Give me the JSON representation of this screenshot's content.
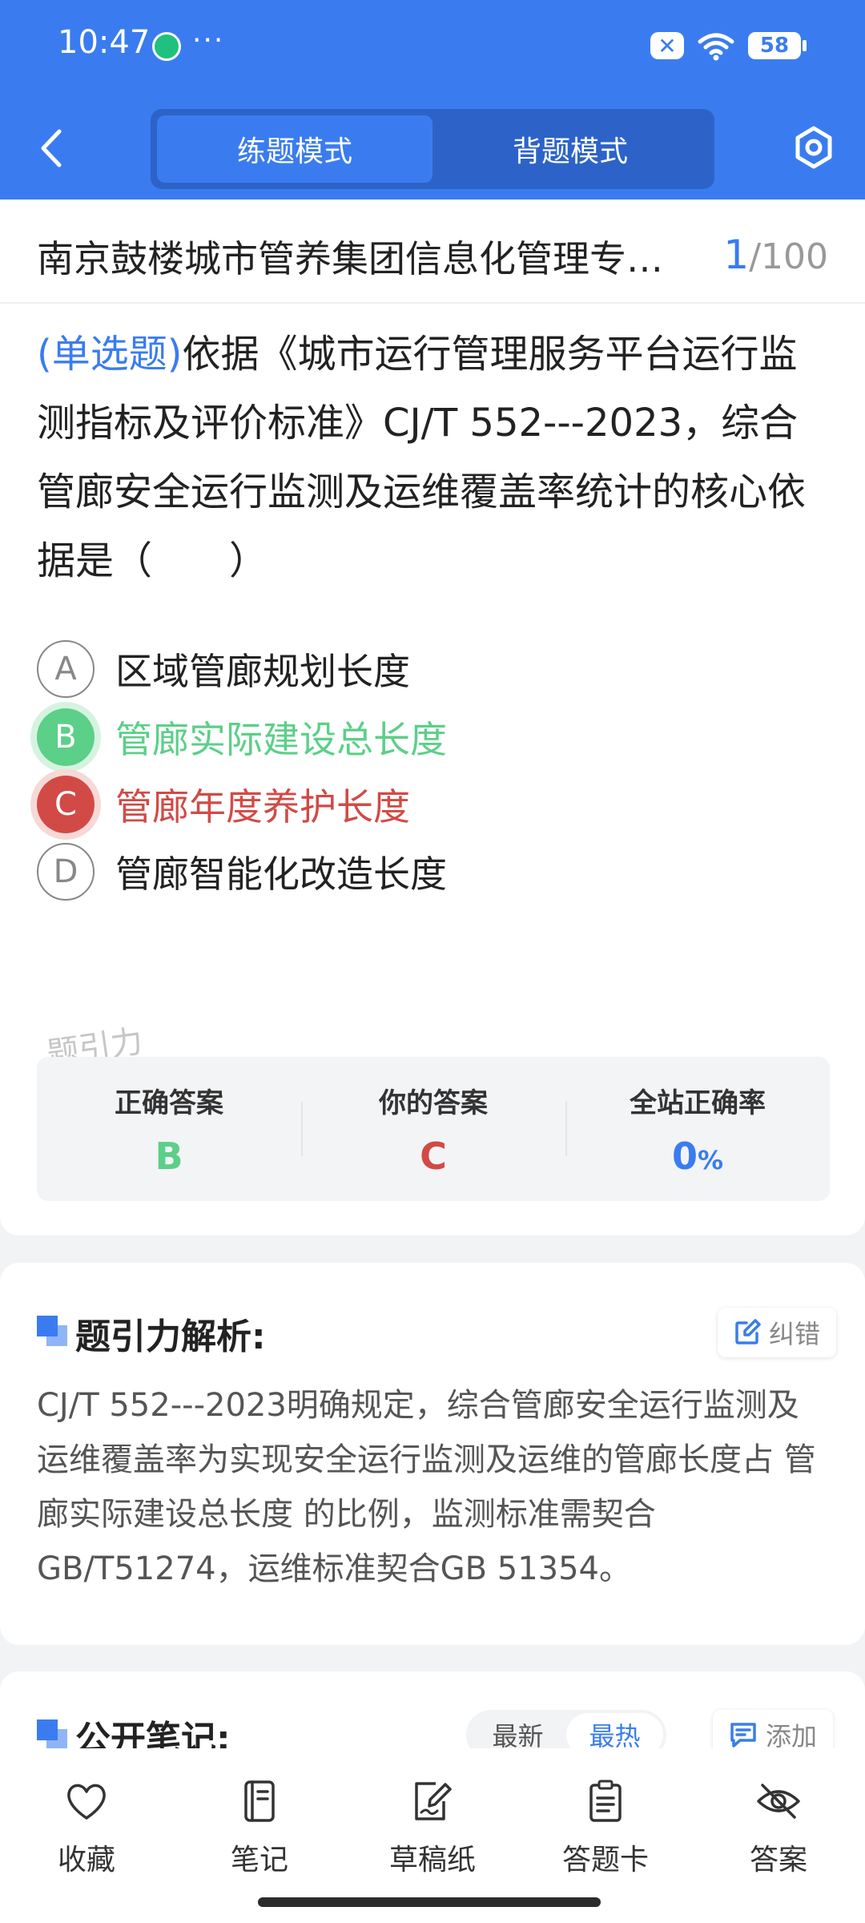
{
  "status_bar": {
    "time": "10:47",
    "battery": "58"
  },
  "header": {
    "modes": [
      {
        "label": "练题模式",
        "active": true
      },
      {
        "label": "背题模式",
        "active": false
      }
    ]
  },
  "question": {
    "title": "南京鼓楼城市管养集团信息化管理专…",
    "current": "1",
    "total": "/100",
    "type_label": "(单选题)",
    "text": "依据《城市运行管理服务平台运行监测指标及评价标准》CJ/T 552---2023，综合管廊安全运行监测及运维覆盖率统计的核心依据是（　　）",
    "options": [
      {
        "letter": "A",
        "text": "区域管廊规划长度",
        "state": "normal"
      },
      {
        "letter": "B",
        "text": "管廊实际建设总长度",
        "state": "correct"
      },
      {
        "letter": "C",
        "text": "管廊年度养护长度",
        "state": "wrong"
      },
      {
        "letter": "D",
        "text": "管廊智能化改造长度",
        "state": "normal"
      }
    ],
    "watermark": "题引力"
  },
  "summary": {
    "correct_label": "正确答案",
    "correct_value": "B",
    "your_label": "你的答案",
    "your_value": "C",
    "rate_label": "全站正确率",
    "rate_value": "0",
    "rate_unit": "%"
  },
  "analysis": {
    "title": "题引力解析:",
    "report_label": "纠错",
    "text": "CJ/T 552---2023明确规定，综合管廊安全运行监测及运维覆盖率为实现安全运行监测及运维的管廊长度占 管廊实际建设总长度 的比例，监测标准需契合GB/T51274，运维标准契合GB 51354。"
  },
  "notes": {
    "title": "公开笔记:",
    "sort_latest": "最新",
    "sort_hot": "最热",
    "add_label": "添加"
  },
  "bottom_tabs": [
    {
      "label": "收藏",
      "icon": "heart-icon"
    },
    {
      "label": "笔记",
      "icon": "notebook-icon"
    },
    {
      "label": "草稿纸",
      "icon": "draft-paper-icon"
    },
    {
      "label": "答题卡",
      "icon": "answer-card-icon"
    },
    {
      "label": "答案",
      "icon": "eye-off-icon"
    }
  ],
  "colors": {
    "primary": "#3a7cf0",
    "correct": "#5ccf88",
    "wrong": "#d24a45"
  }
}
